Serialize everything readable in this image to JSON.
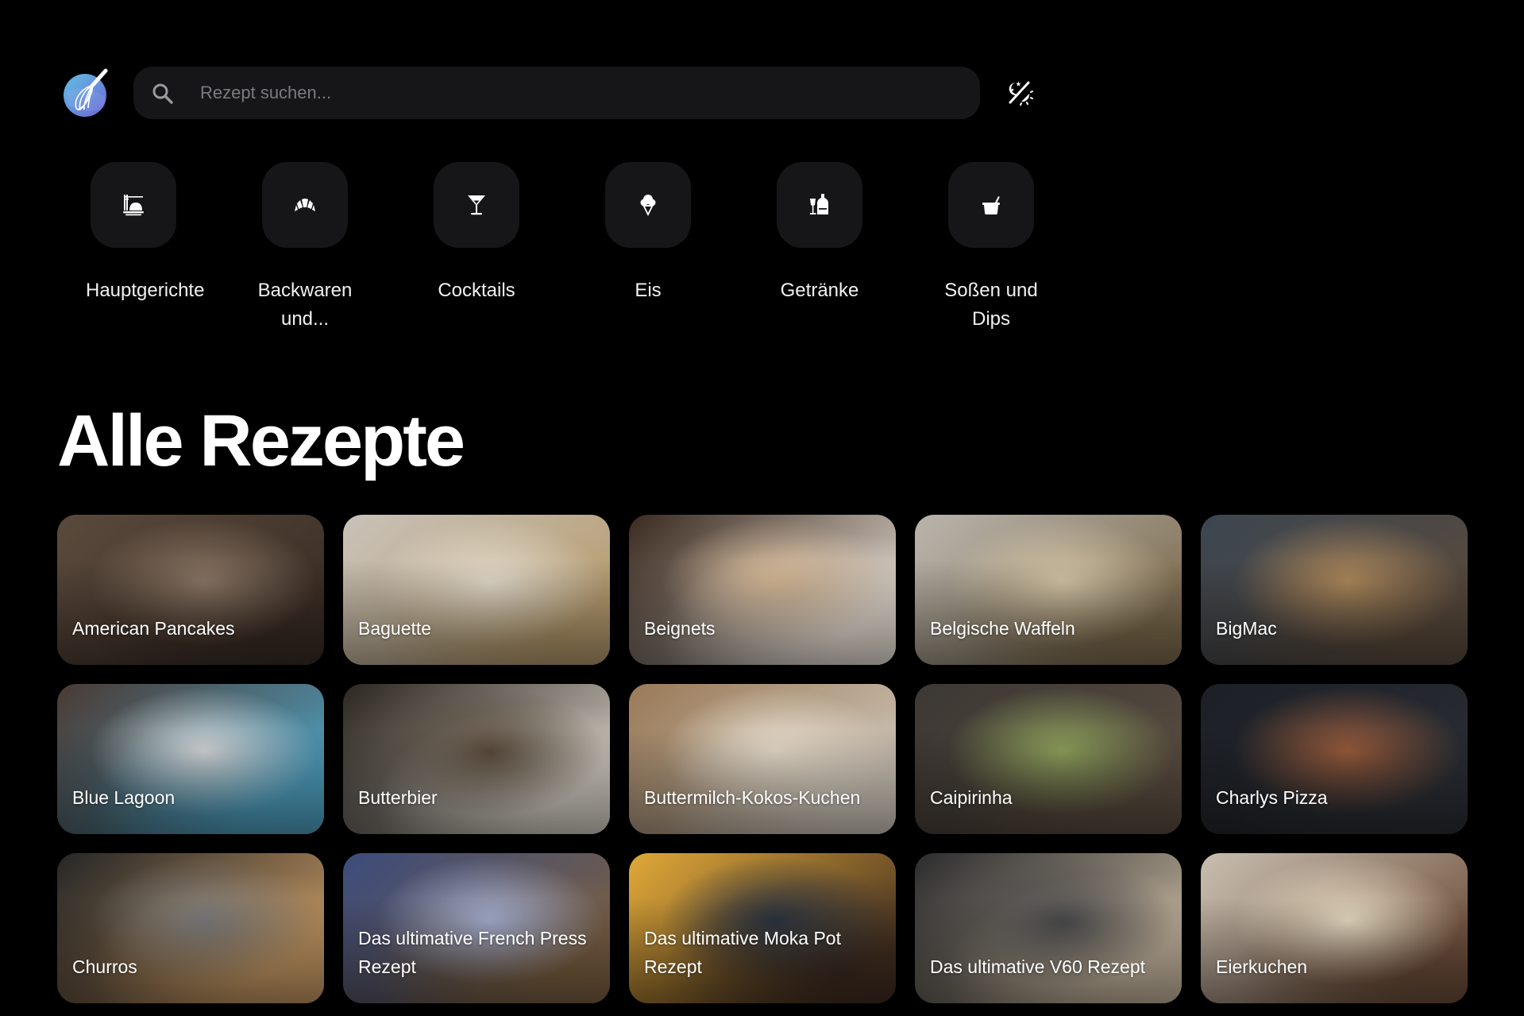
{
  "header": {
    "logo_icon": "whisk-icon",
    "search": {
      "placeholder": "Rezept suchen...",
      "value": "",
      "icon": "search-icon"
    },
    "theme_toggle_icon": "theme-toggle-icon"
  },
  "categories": [
    {
      "label": "Hauptgerichte",
      "icon": "main-dish-icon"
    },
    {
      "label": "Backwaren und...",
      "icon": "croissant-icon"
    },
    {
      "label": "Cocktails",
      "icon": "cocktail-icon"
    },
    {
      "label": "Eis",
      "icon": "ice-cream-icon"
    },
    {
      "label": "Getränke",
      "icon": "drinks-icon"
    },
    {
      "label": "Soßen und Dips",
      "icon": "sauce-pot-icon"
    }
  ],
  "section": {
    "title": "Alle Rezepte"
  },
  "recipes": [
    {
      "title": "American Pancakes",
      "colors": [
        "#5a4a3c",
        "#8c7866",
        "#3a2c24"
      ]
    },
    {
      "title": "Baguette",
      "colors": [
        "#c9c2b8",
        "#e4dccd",
        "#b59a6c"
      ]
    },
    {
      "title": "Beignets",
      "colors": [
        "#3a2a20",
        "#d7b996",
        "#ece3d8"
      ]
    },
    {
      "title": "Belgische Waffeln",
      "colors": [
        "#b9b4ac",
        "#d6c7a8",
        "#7c6a4c"
      ]
    },
    {
      "title": "BigMac",
      "colors": [
        "#3c4650",
        "#b08a5c",
        "#5a4a3c"
      ]
    },
    {
      "title": "Blue Lagoon",
      "colors": [
        "#4a3a34",
        "#d4d6d8",
        "#4fa3c4"
      ]
    },
    {
      "title": "Butterbier",
      "colors": [
        "#2c2620",
        "#5a4c3c",
        "#d8d2c8"
      ]
    },
    {
      "title": "Buttermilch-Kokos-Kuchen",
      "colors": [
        "#9a7a58",
        "#e6dccb",
        "#d0c8bc"
      ]
    },
    {
      "title": "Caipirinha",
      "colors": [
        "#3c3834",
        "#8ea25c",
        "#5a4c40"
      ]
    },
    {
      "title": "Charlys Pizza",
      "colors": [
        "#1c2026",
        "#9a5c3c",
        "#2a2e34"
      ]
    },
    {
      "title": "Churros",
      "colors": [
        "#262626",
        "#7c7c7c",
        "#c89a64"
      ]
    },
    {
      "title": "Das ultimative French Press Rezept",
      "colors": [
        "#3c4c7c",
        "#a4aed0",
        "#7c6040"
      ]
    },
    {
      "title": "Das ultimative Moka Pot Rezept",
      "colors": [
        "#e0a838",
        "#2c3440",
        "#3c2a20"
      ]
    },
    {
      "title": "Das ultimative V60 Rezept",
      "colors": [
        "#2c2c2e",
        "#4a4a4c",
        "#c8b8a0"
      ]
    },
    {
      "title": "Eierkuchen",
      "colors": [
        "#c8beb0",
        "#e8dcc4",
        "#6c4c38"
      ]
    }
  ],
  "colors": {
    "background": "#000000",
    "surface": "#161618",
    "text": "#ffffff",
    "placeholder": "#7b7b80",
    "logo_gradient": [
      "#5fb8e0",
      "#6a6fd8"
    ]
  }
}
